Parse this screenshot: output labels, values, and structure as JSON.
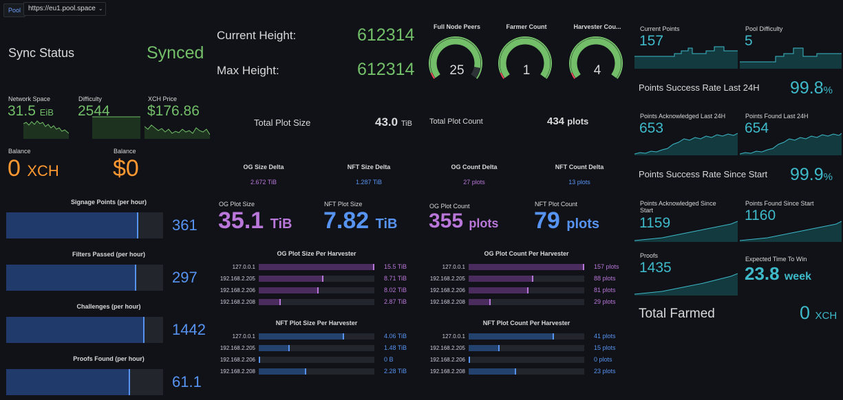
{
  "topbar": {
    "badge": "Pool",
    "pool_url": "https://eu1.pool.space"
  },
  "sync": {
    "label": "Sync Status",
    "value": "Synced"
  },
  "network": {
    "label": "Network Space",
    "value": "31.5",
    "unit": "EiB"
  },
  "difficulty": {
    "label": "Difficulty",
    "value": "2544"
  },
  "price": {
    "label": "XCH Price",
    "value": "$176.86"
  },
  "balance_xch": {
    "label": "Balance",
    "value": "0",
    "unit": "XCH"
  },
  "balance_usd": {
    "label": "Balance",
    "value": "$0"
  },
  "signage": {
    "label": "Signage Points (per hour)",
    "value": "361",
    "fill": 0.84
  },
  "filters": {
    "label": "Filters Passed (per hour)",
    "value": "297",
    "fill": 0.83
  },
  "challenges": {
    "label": "Challenges (per hour)",
    "value": "1442",
    "fill": 0.88
  },
  "proofs_found": {
    "label": "Proofs Found (per hour)",
    "value": "61.1",
    "fill": 0.79
  },
  "heights": {
    "current_label": "Current Height:",
    "current_value": "612314",
    "max_label": "Max Height:",
    "max_value": "612314"
  },
  "gauges": [
    {
      "label": "Full Node Peers",
      "value": "25",
      "fill": 0.9,
      "color": "#73bf69"
    },
    {
      "label": "Farmer Count",
      "value": "1",
      "fill": 1.0,
      "color": "#73bf69"
    },
    {
      "label": "Harvester Cou...",
      "value": "4",
      "fill": 1.0,
      "color": "#73bf69"
    }
  ],
  "total_plot_size": {
    "label": "Total Plot Size",
    "value": "43.0",
    "unit": "TiB"
  },
  "total_plot_count": {
    "label": "Total Plot Count",
    "value": "434",
    "unit": "plots"
  },
  "deltas": [
    {
      "label": "OG Size Delta",
      "value": "2.672 TiB",
      "color": "#b877d9"
    },
    {
      "label": "NFT Size Delta",
      "value": "1.287 TiB",
      "color": "#5794f2"
    },
    {
      "label": "OG Count Delta",
      "value": "27 plots",
      "color": "#b877d9"
    },
    {
      "label": "NFT Count Delta",
      "value": "13 plots",
      "color": "#5794f2"
    }
  ],
  "og_plot_size": {
    "label": "OG Plot Size",
    "value": "35.1",
    "unit": "TiB"
  },
  "nft_plot_size": {
    "label": "NFT Plot Size",
    "value": "7.82",
    "unit": "TiB"
  },
  "og_plot_count": {
    "label": "OG Plot Count",
    "value": "355",
    "unit": "plots"
  },
  "nft_plot_count": {
    "label": "NFT Plot Count",
    "value": "79",
    "unit": "plots"
  },
  "og_size_per_harvester": {
    "title": "OG Plot Size Per Harvester",
    "rows": [
      {
        "host": "127.0.0.1",
        "value": "15.5 TiB",
        "fill": 1.0
      },
      {
        "host": "192.168.2.205",
        "value": "8.71 TiB",
        "fill": 0.56
      },
      {
        "host": "192.168.2.206",
        "value": "8.02 TiB",
        "fill": 0.52
      },
      {
        "host": "192.168.2.208",
        "value": "2.87 TiB",
        "fill": 0.19
      }
    ]
  },
  "og_count_per_harvester": {
    "title": "OG Plot Count Per Harvester",
    "rows": [
      {
        "host": "127.0.0.1",
        "value": "157 plots",
        "fill": 1.0
      },
      {
        "host": "192.168.2.205",
        "value": "88 plots",
        "fill": 0.56
      },
      {
        "host": "192.168.2.206",
        "value": "81 plots",
        "fill": 0.52
      },
      {
        "host": "192.168.2.208",
        "value": "29 plots",
        "fill": 0.19
      }
    ]
  },
  "nft_size_per_harvester": {
    "title": "NFT Plot Size Per Harvester",
    "rows": [
      {
        "host": "127.0.0.1",
        "value": "4.06 TiB",
        "fill": 0.74
      },
      {
        "host": "192.168.2.205",
        "value": "1.48 TiB",
        "fill": 0.27
      },
      {
        "host": "192.168.2.206",
        "value": "0 B",
        "fill": 0.0
      },
      {
        "host": "192.168.2.208",
        "value": "2.28 TiB",
        "fill": 0.41
      }
    ]
  },
  "nft_count_per_harvester": {
    "title": "NFT Plot Count Per Harvester",
    "rows": [
      {
        "host": "127.0.0.1",
        "value": "41 plots",
        "fill": 0.74
      },
      {
        "host": "192.168.2.205",
        "value": "15 plots",
        "fill": 0.27
      },
      {
        "host": "192.168.2.206",
        "value": "0 plots",
        "fill": 0.0
      },
      {
        "host": "192.168.2.208",
        "value": "23 plots",
        "fill": 0.41
      }
    ]
  },
  "pool": {
    "current_points": {
      "label": "Current Points",
      "value": "157"
    },
    "pool_difficulty": {
      "label": "Pool Difficulty",
      "value": "5"
    },
    "success_24h": {
      "label": "Points Success Rate Last 24H",
      "value": "99.8",
      "unit": "%"
    },
    "ack_24h": {
      "label": "Points Acknowledged Last 24H",
      "value": "653"
    },
    "found_24h": {
      "label": "Points Found Last 24H",
      "value": "654"
    },
    "success_start": {
      "label": "Points Success Rate Since Start",
      "value": "99.9",
      "unit": "%"
    },
    "ack_start": {
      "label": "Points Acknowledged Since Start",
      "value": "1159"
    },
    "found_start": {
      "label": "Points Found Since Start",
      "value": "1160"
    },
    "proofs": {
      "label": "Proofs",
      "value": "1435"
    },
    "ettw": {
      "label": "Expected Time To Win",
      "value": "23.8",
      "unit": "week"
    },
    "total_farmed": {
      "label": "Total Farmed",
      "value": "0",
      "unit": "XCH"
    }
  },
  "colors": {
    "green": "#73bf69",
    "orange": "#ff9830",
    "purple": "#b877d9",
    "blue": "#5794f2",
    "teal": "#3ebaca"
  }
}
